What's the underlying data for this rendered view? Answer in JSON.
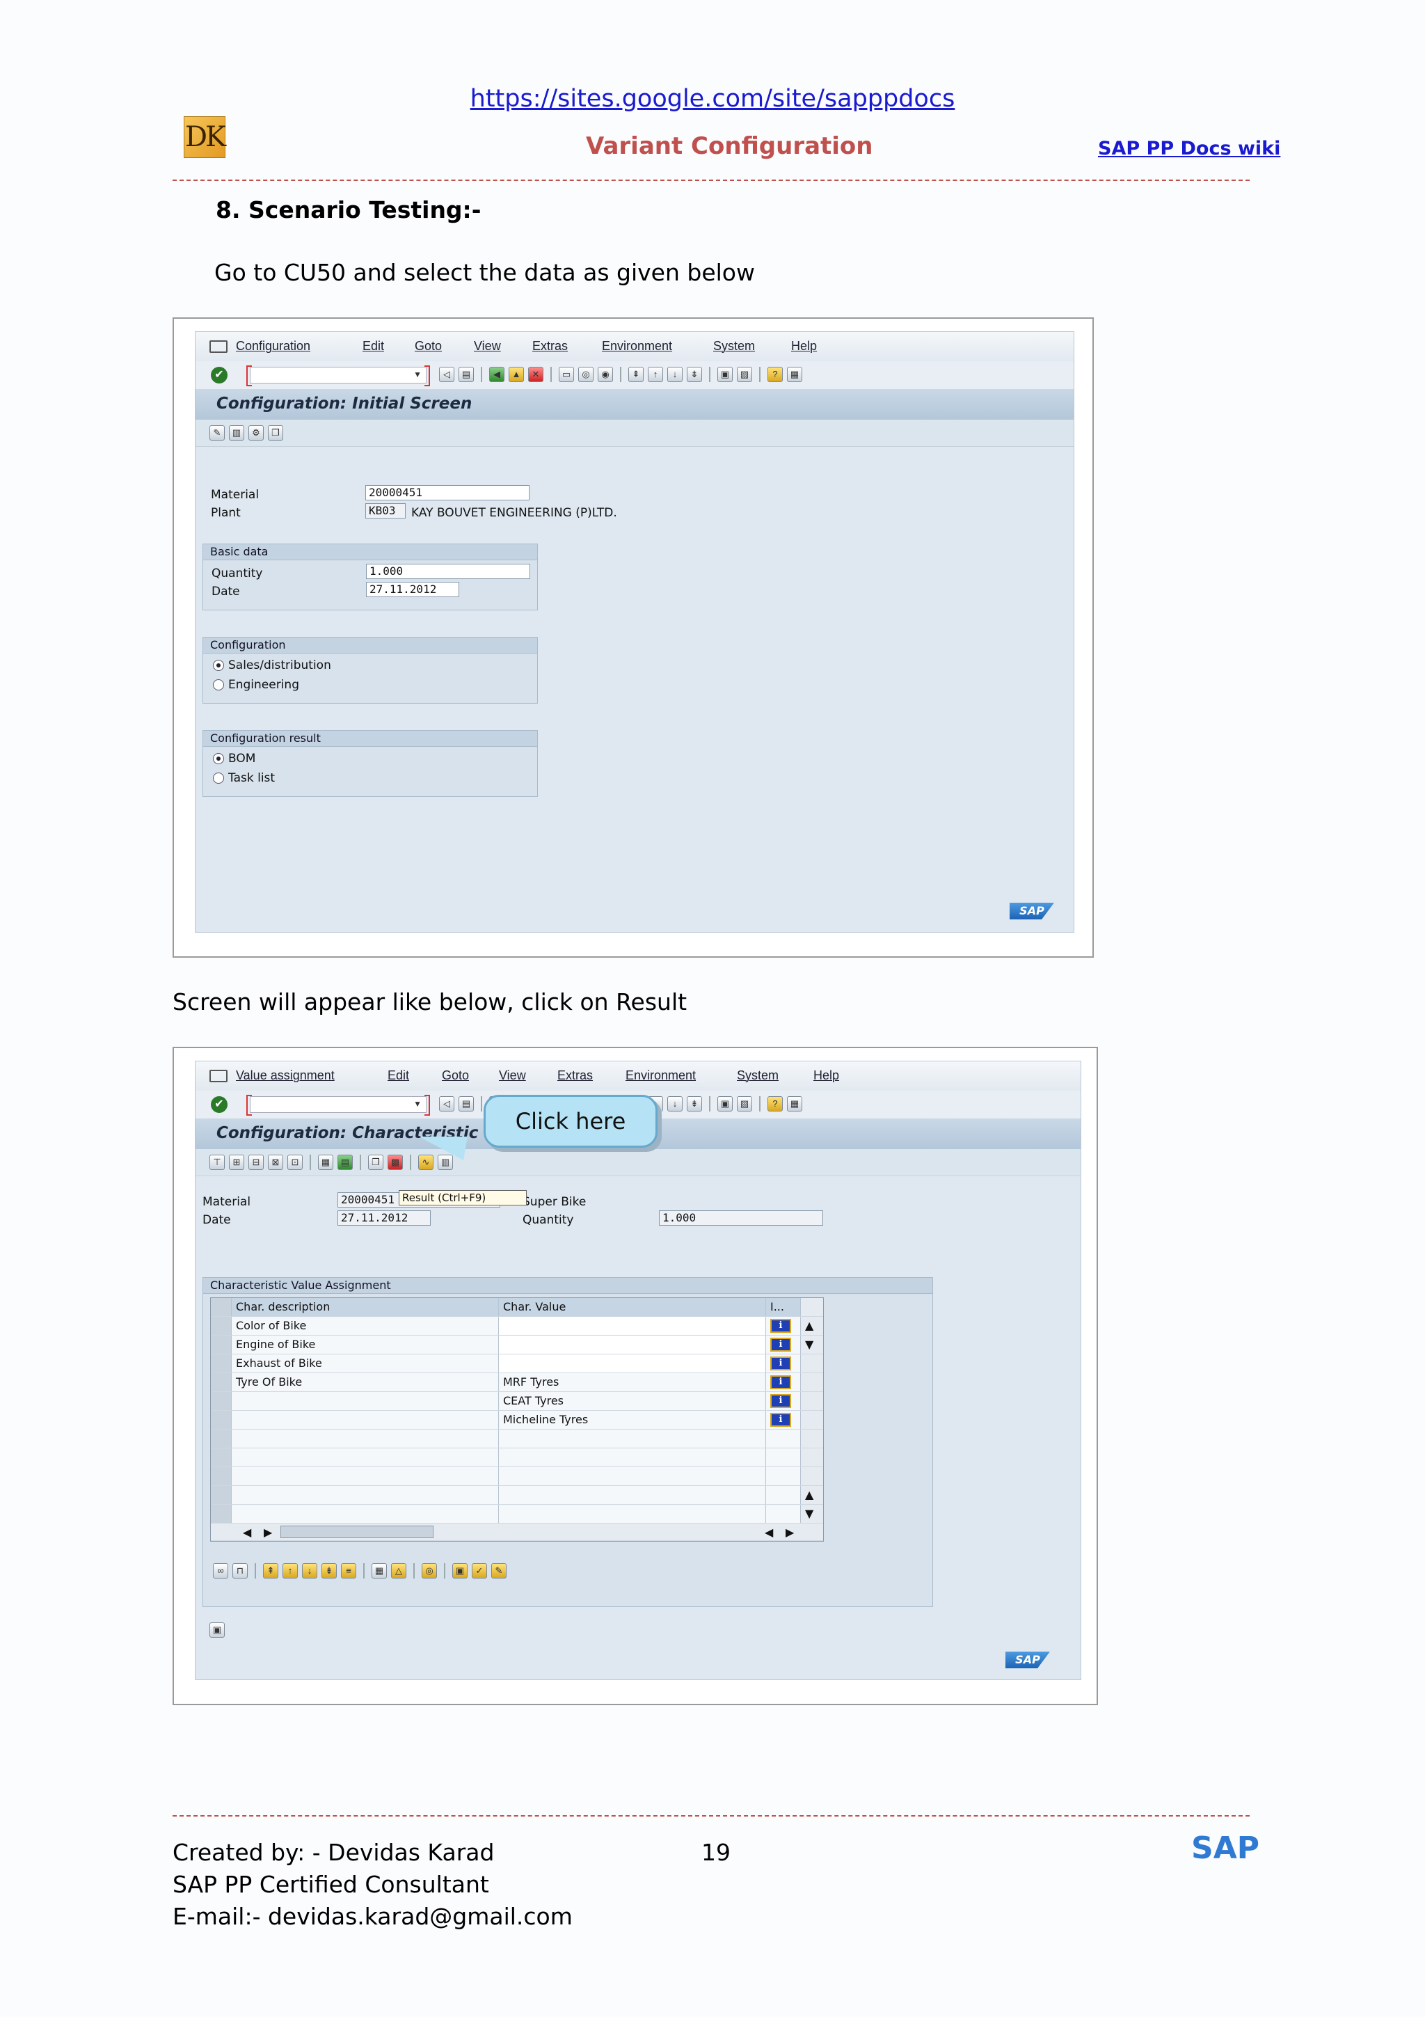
{
  "header": {
    "url": "https://sites.google.com/site/sapppdocs",
    "logo_text": "DK",
    "title": "Variant Configuration",
    "wiki_link": "SAP PP Docs wiki"
  },
  "content": {
    "section_heading": "8.   Scenario Testing:-",
    "instruction_1": "Go to CU50 and select the data as given below",
    "instruction_2": "Screen will appear like below, click on Result"
  },
  "screen1": {
    "menu": [
      "Configuration",
      "Edit",
      "Goto",
      "View",
      "Extras",
      "Environment",
      "System",
      "Help"
    ],
    "title": "Configuration: Initial Screen",
    "material_label": "Material",
    "material_value": "20000451",
    "plant_label": "Plant",
    "plant_value": "KB03",
    "plant_name": "KAY BOUVET ENGINEERING (P)LTD.",
    "basic_data": {
      "title": "Basic data",
      "quantity_label": "Quantity",
      "quantity_value": "1.000",
      "date_label": "Date",
      "date_value": "27.11.2012"
    },
    "configuration": {
      "title": "Configuration",
      "options": [
        "Sales/distribution",
        "Engineering"
      ],
      "selected": "Sales/distribution"
    },
    "config_result": {
      "title": "Configuration result",
      "options": [
        "BOM",
        "Task list"
      ],
      "selected": "BOM"
    },
    "sap_logo": "SAP"
  },
  "screen2": {
    "menu": [
      "Value assignment",
      "Edit",
      "Goto",
      "View",
      "Extras",
      "Environment",
      "System",
      "Help"
    ],
    "title": "Configuration: Characteristic Value Assignment",
    "callout": "Click here",
    "tooltip": "Result   (Ctrl+F9)",
    "material_label": "Material",
    "material_value": "20000451",
    "material_desc": "Super Bike",
    "date_label": "Date",
    "date_value": "27.11.2012",
    "quantity_label": "Quantity",
    "quantity_value": "1.000",
    "table": {
      "title": "Characteristic Value Assignment",
      "columns": [
        "Char. description",
        "Char. Value",
        "I..."
      ],
      "rows": [
        {
          "desc": "Color of Bike",
          "value": ""
        },
        {
          "desc": "Engine of Bike",
          "value": ""
        },
        {
          "desc": "Exhaust of Bike",
          "value": ""
        },
        {
          "desc": "Tyre Of Bike",
          "value": "MRF Tyres"
        },
        {
          "desc": "",
          "value": "CEAT Tyres"
        },
        {
          "desc": "",
          "value": "Micheline Tyres"
        }
      ],
      "info_icon": "i"
    },
    "sap_logo": "SAP"
  },
  "footer": {
    "created_by": "Created by: - Devidas Karad",
    "role": "SAP PP Certified Consultant",
    "email": "E-mail:- devidas.karad@gmail.com",
    "page": "19",
    "brand": "SAP"
  },
  "colors": {
    "title_red": "#c0504d",
    "link_blue": "#1a1ad0",
    "sap_blue": "#2f7ad2"
  }
}
